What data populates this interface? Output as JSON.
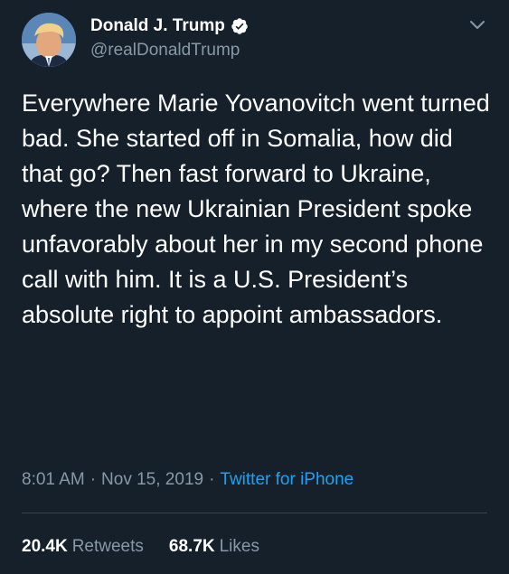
{
  "author": {
    "display_name": "Donald J. Trump",
    "handle": "@realDonaldTrump",
    "verified": true,
    "avatar_icon": "profile-photo-icon"
  },
  "tweet": {
    "text": "Everywhere Marie Yovanovitch went turned bad. She started off in Somalia, how did that go? Then fast forward to Ukraine, where the new Ukrainian President spoke unfavorably about her in my second phone call with him. It is a U.S. President’s absolute right to appoint ambassadors.",
    "time": "8:01 AM",
    "separator": "·",
    "date": "Nov 15, 2019",
    "source": "Twitter for iPhone"
  },
  "stats": {
    "retweets_count": "20.4K",
    "retweets_label": "Retweets",
    "likes_count": "68.7K",
    "likes_label": "Likes"
  },
  "colors": {
    "background": "#15202b",
    "text_primary": "#ffffff",
    "text_secondary": "#8899a6",
    "accent": "#1da1f2",
    "divider": "#38444d"
  }
}
